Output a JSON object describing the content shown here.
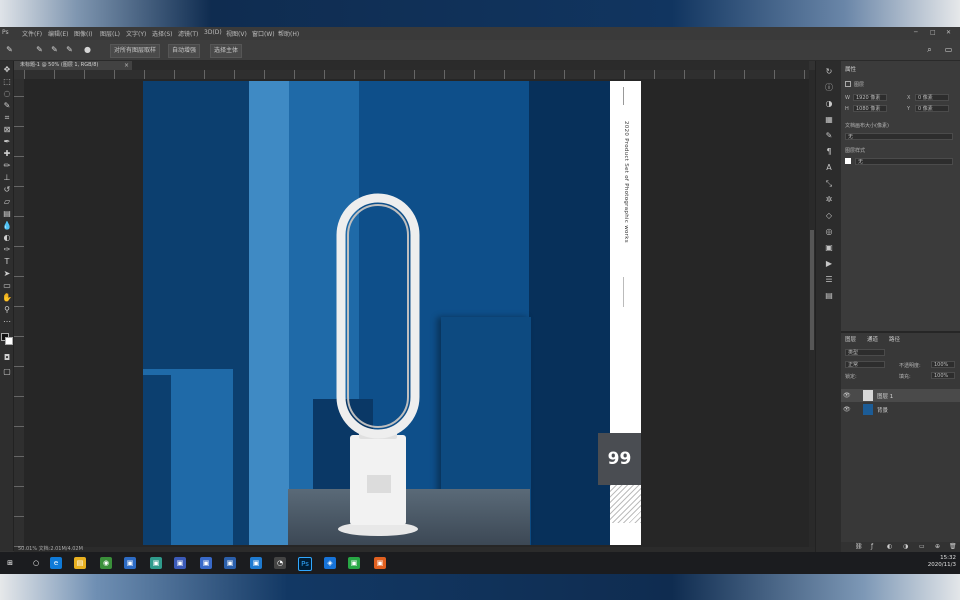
{
  "app": {
    "menu": [
      "文件(F)",
      "编辑(E)",
      "图像(I)",
      "图层(L)",
      "文字(Y)",
      "选择(S)",
      "滤镜(T)",
      "3D(D)",
      "视图(V)",
      "窗口(W)",
      "帮助(H)"
    ],
    "options": {
      "btn1": "对所有图层取样",
      "btn2": "自动增强",
      "btn3": "选择主体"
    },
    "doc_tab": "未标题-1 @ 50% (图层 1, RGB/8)",
    "doc_tab_close": "×",
    "status": "50.01%   文档:2.01M/4.02M"
  },
  "artwork": {
    "vertical_label": "2020 Product Set of Photographic works",
    "price": "99"
  },
  "properties": {
    "tab": "属性",
    "layer_kind": "图层",
    "w_label": "W",
    "w_value": "1920 像素",
    "h_label": "H",
    "h_value": "1080 像素",
    "x_label": "X",
    "x_value": "0 像素",
    "y_label": "Y",
    "y_value": "0 像素",
    "section1": "文档画布大小(像素)",
    "select1": "无",
    "section2": "图层样式",
    "select2": "无"
  },
  "layers": {
    "tabs": [
      "图层",
      "通道",
      "路径"
    ],
    "kind": "类型",
    "blend": "正常",
    "opacity_label": "不透明度:",
    "opacity": "100%",
    "lock_label": "锁定:",
    "fill_label": "填充:",
    "fill": "100%",
    "items": [
      {
        "name": "图层 1"
      },
      {
        "name": "背景"
      }
    ]
  },
  "taskbar": {
    "time": "15:32",
    "date": "2020/11/3"
  },
  "colors": {
    "ps_bg": "#323232",
    "accent_blue": "#0e3d6b",
    "taskbar": "#1b1c1f"
  }
}
